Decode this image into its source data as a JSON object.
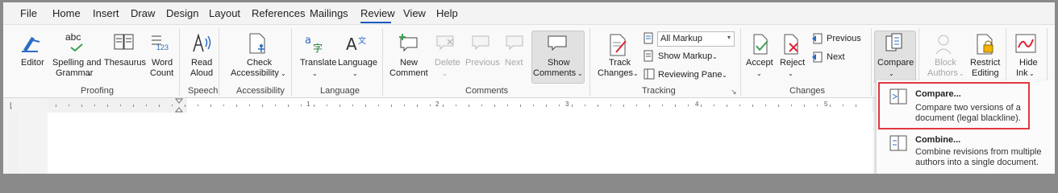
{
  "tabs": [
    "File",
    "Home",
    "Insert",
    "Draw",
    "Design",
    "Layout",
    "References",
    "Mailings",
    "Review",
    "View",
    "Help"
  ],
  "active_tab": "Review",
  "proofing": {
    "editor": "Editor",
    "spelling_line1": "Spelling and",
    "spelling_line2": "Grammar",
    "thesaurus": "Thesaurus",
    "word_count_line1": "Word",
    "word_count_line2": "Count",
    "group": "Proofing",
    "abc": "abc",
    "num123": "123"
  },
  "speech": {
    "read_line1": "Read",
    "read_line2": "Aloud",
    "group": "Speech"
  },
  "accessibility": {
    "check_line1": "Check",
    "check_line2": "Accessibility",
    "group": "Accessibility"
  },
  "language": {
    "translate": "Translate",
    "language": "Language",
    "group": "Language"
  },
  "comments": {
    "new_line1": "New",
    "new_line2": "Comment",
    "delete": "Delete",
    "previous": "Previous",
    "next": "Next",
    "show_line1": "Show",
    "show_line2": "Comments",
    "group": "Comments"
  },
  "tracking": {
    "track_line1": "Track",
    "track_line2": "Changes",
    "markup_select": "All Markup",
    "show_markup": "Show Markup",
    "reviewing_pane": "Reviewing Pane",
    "group": "Tracking"
  },
  "changes": {
    "accept": "Accept",
    "reject": "Reject",
    "previous": "Previous",
    "next": "Next",
    "group": "Changes"
  },
  "compare": {
    "compare": "Compare"
  },
  "protect": {
    "block_line1": "Block",
    "block_line2": "Authors",
    "restrict_line1": "Restrict",
    "restrict_line2": "Editing"
  },
  "ink": {
    "hide_line1": "Hide",
    "hide_line2": "Ink"
  },
  "ruler_numbers": [
    "1",
    "2",
    "3",
    "4",
    "5"
  ],
  "compare_menu": {
    "compare_title": "Compare...",
    "compare_desc_line1": "Compare two versions of a",
    "compare_desc_line2": "document (legal blackline).",
    "combine_title": "Combine...",
    "combine_desc_line1": "Combine revisions from multiple",
    "combine_desc_line2": "authors into a single document."
  },
  "colors": {
    "accent": "#185abd",
    "highlight_border": "#e0373f"
  }
}
